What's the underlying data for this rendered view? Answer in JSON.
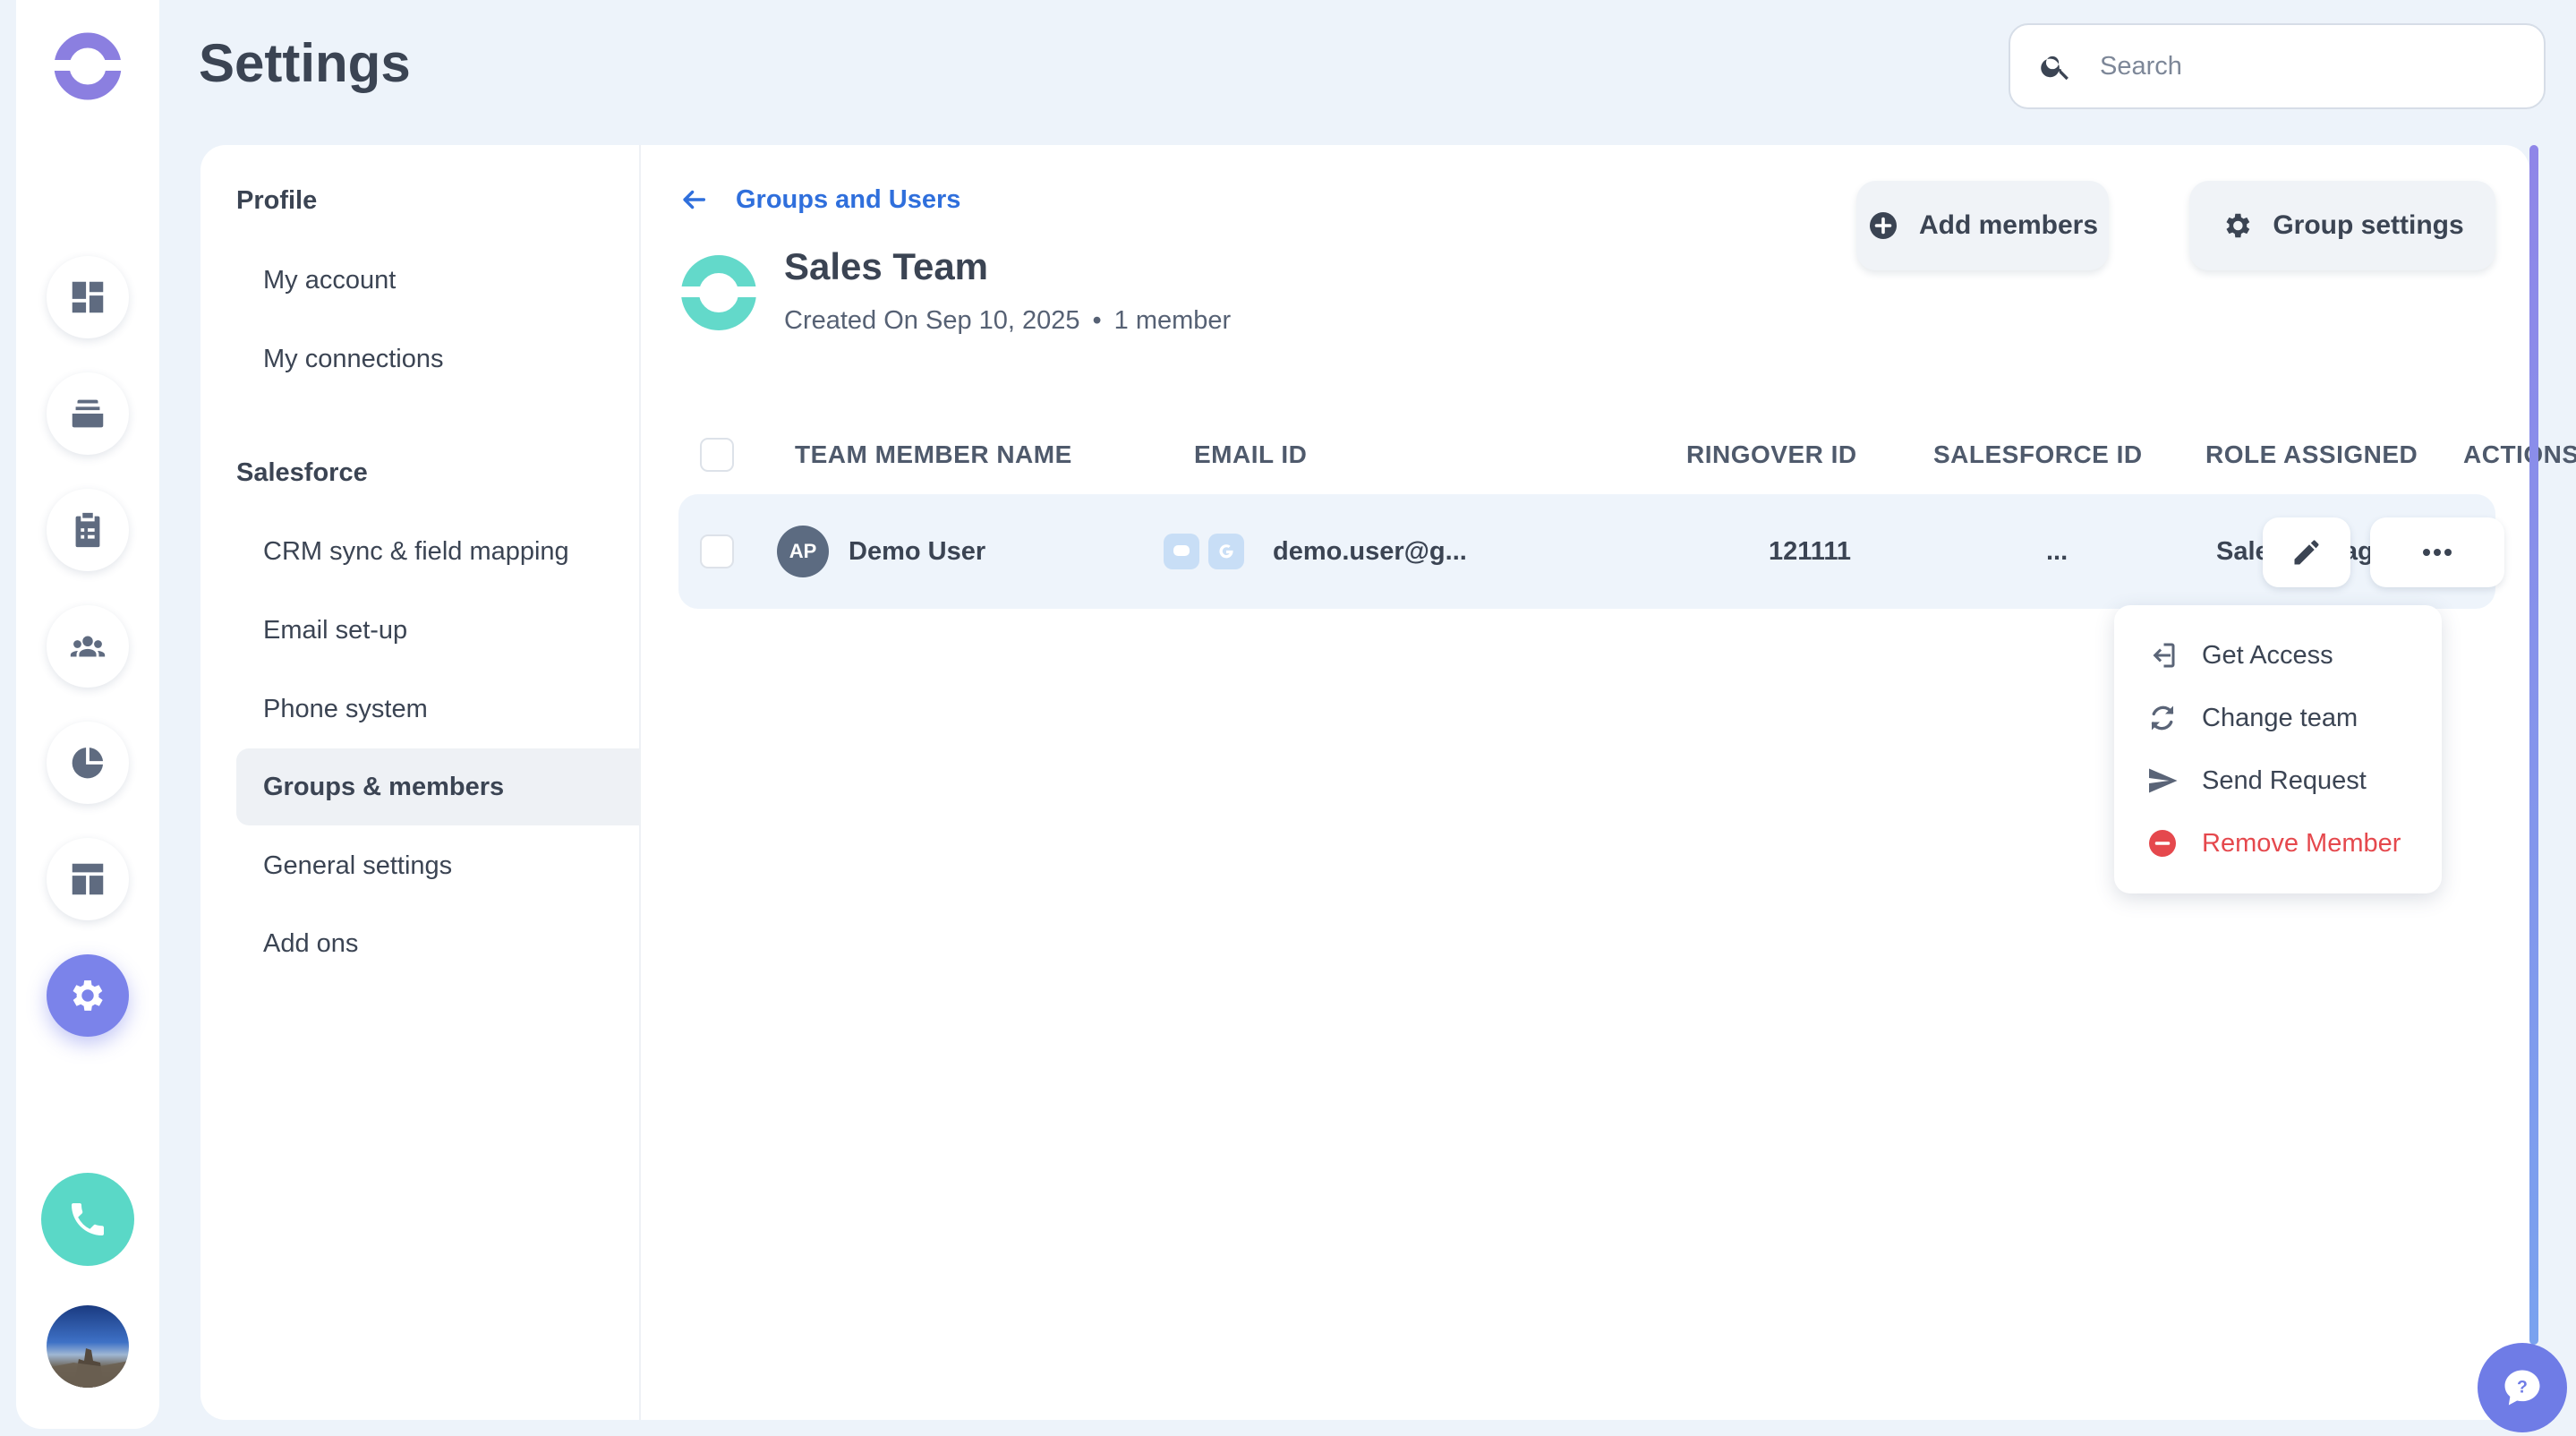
{
  "header": {
    "title": "Settings",
    "search_placeholder": "Search"
  },
  "rail": {
    "logo_icon": "brand-ring-icon",
    "items": [
      {
        "icon": "dashboard-icon"
      },
      {
        "icon": "inbox-stack-icon"
      },
      {
        "icon": "clipboard-icon"
      },
      {
        "icon": "team-icon"
      },
      {
        "icon": "pie-chart-icon"
      },
      {
        "icon": "layout-icon"
      },
      {
        "icon": "gear-icon",
        "active": true
      }
    ],
    "accent_color": "#7b83ea",
    "phone_color": "#5ad8c7"
  },
  "settings_nav": {
    "sections": [
      {
        "title": "Profile",
        "items": [
          "My account",
          "My connections"
        ]
      },
      {
        "title": "Salesforce",
        "items": [
          "CRM sync & field mapping",
          "Email set-up",
          "Phone system",
          "Groups & members",
          "General settings",
          "Add ons"
        ]
      }
    ],
    "active_item": "Groups & members"
  },
  "group": {
    "back_label": "Groups and Users",
    "name": "Sales Team",
    "created": "Created On Sep 10, 2025",
    "separator": "•",
    "member_count": "1 member",
    "add_members_label": "Add members",
    "group_settings_label": "Group settings"
  },
  "table": {
    "columns": [
      "TEAM MEMBER NAME",
      "EMAIL ID",
      "RINGOVER ID",
      "SALESFORCE ID",
      "ROLE ASSIGNED",
      "ACTIONS"
    ],
    "rows": [
      {
        "initials": "AP",
        "name": "Demo User",
        "email": "demo.user@g...",
        "ringover_id": "121111",
        "salesforce_id": "...",
        "role": "Sales Manager"
      }
    ]
  },
  "actions_menu": {
    "items": [
      {
        "label": "Get Access",
        "icon": "sign-in-icon"
      },
      {
        "label": "Change team",
        "icon": "refresh-icon"
      },
      {
        "label": "Send Request",
        "icon": "send-icon"
      },
      {
        "label": "Remove Member",
        "icon": "remove-circle-icon",
        "danger": true
      }
    ],
    "danger_color": "#e5484d"
  },
  "link_color": "#2f6fdc"
}
